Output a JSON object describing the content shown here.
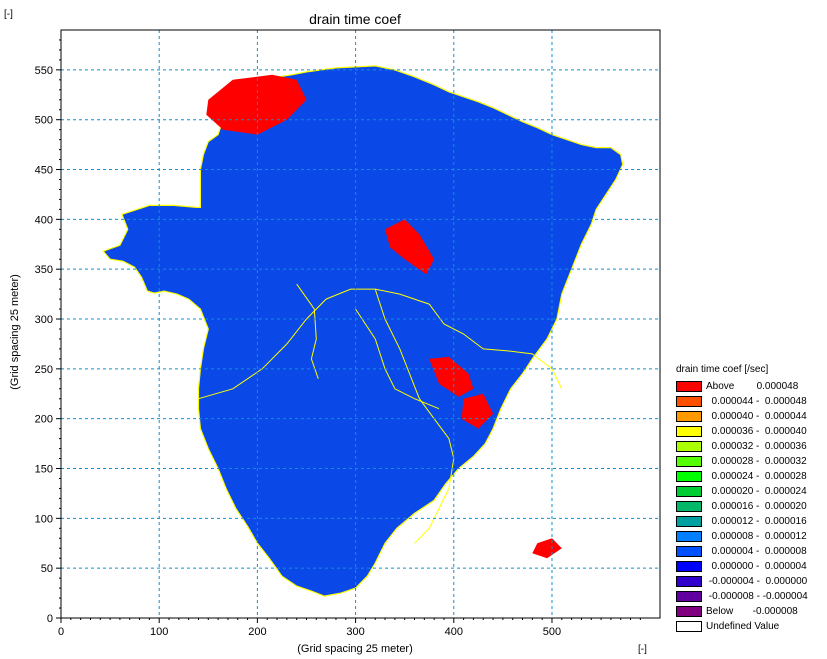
{
  "chart_data": {
    "type": "heatmap",
    "title": "drain time coef",
    "xlabel": "(Grid spacing 25 meter)",
    "ylabel": "(Grid spacing 25 meter)",
    "x_unit": "[-]",
    "y_unit": "[-]",
    "xlim": [
      0,
      610
    ],
    "ylim": [
      0,
      590
    ],
    "x_ticks": [
      "0",
      "100",
      "200",
      "300",
      "400",
      "500"
    ],
    "y_ticks": [
      "0",
      "50",
      "100",
      "150",
      "200",
      "250",
      "300",
      "350",
      "400",
      "450",
      "500",
      "550"
    ],
    "grid": true,
    "legend_position": "right",
    "legend": {
      "title": "drain time coef [/sec]",
      "entries": [
        {
          "label": "Above        0.000048",
          "color": "#ff0000"
        },
        {
          "label": "  0.000044 -  0.000048",
          "color": "#ff5000"
        },
        {
          "label": "  0.000040 -  0.000044",
          "color": "#ff9900"
        },
        {
          "label": "  0.000036 -  0.000040",
          "color": "#ffff00"
        },
        {
          "label": "  0.000032 -  0.000036",
          "color": "#aaff00"
        },
        {
          "label": "  0.000028 -  0.000032",
          "color": "#55ff00"
        },
        {
          "label": "  0.000024 -  0.000028",
          "color": "#00ff00"
        },
        {
          "label": "  0.000020 -  0.000024",
          "color": "#00cc33"
        },
        {
          "label": "  0.000016 -  0.000020",
          "color": "#00b868"
        },
        {
          "label": "  0.000012 -  0.000016",
          "color": "#00a0a0"
        },
        {
          "label": "  0.000008 -  0.000012",
          "color": "#0080ff"
        },
        {
          "label": "  0.000004 -  0.000008",
          "color": "#0050ff"
        },
        {
          "label": "  0.000000 -  0.000004",
          "color": "#0000ff"
        },
        {
          "label": " -0.000004 -  0.000000",
          "color": "#3000cc"
        },
        {
          "label": " -0.000008 - -0.000004",
          "color": "#6000a0"
        },
        {
          "label": "Below       -0.000008",
          "color": "#800080"
        },
        {
          "label": "Undefined Value",
          "color": "#ffffff"
        }
      ]
    },
    "colors": {
      "catchment_fill": "#0a48e8",
      "high_value": "#ff0000",
      "gridline": "#1090d0",
      "boundary": "#ffff00"
    }
  }
}
